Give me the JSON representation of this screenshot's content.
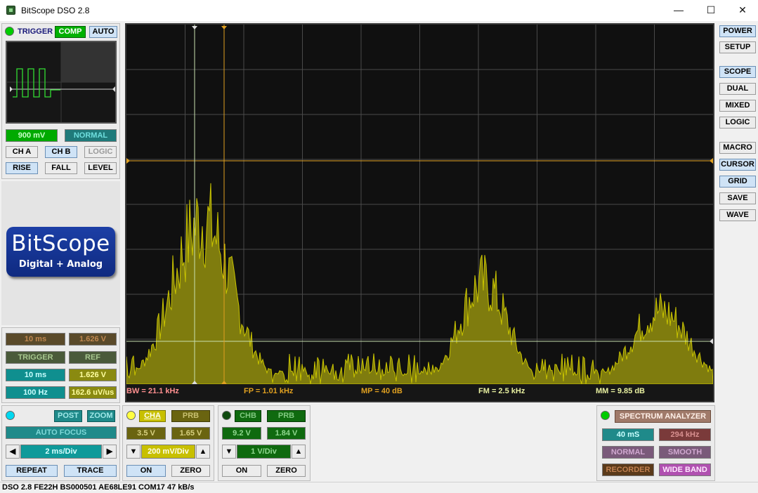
{
  "window": {
    "title": "BitScope DSO 2.8",
    "minimize": "—",
    "maximize": "☐",
    "close": "✕"
  },
  "trigger": {
    "label": "TRIGGER",
    "comp": "COMP",
    "auto": "AUTO",
    "level": "900 mV",
    "mode": "NORMAL",
    "ch_a": "CH A",
    "ch_b": "CH B",
    "logic": "LOGIC",
    "rise": "RISE",
    "fall": "FALL",
    "level_btn": "LEVEL"
  },
  "logo": {
    "line1": "BitScope",
    "line2": "Digital + Analog"
  },
  "timebase_info": {
    "r1a": "10 ms",
    "r1b": "1.626 V",
    "r2a": "TRIGGER",
    "r2b": "REF",
    "r3a": "10 ms",
    "r3b": "1.626 V",
    "r4a": "100 Hz",
    "r4b": "162.6 uV/us"
  },
  "timebase": {
    "post": "POST",
    "zoom": "ZOOM",
    "autofocus": "AUTO FOCUS",
    "value": "2 ms/Div",
    "left": "◀",
    "right": "▶",
    "repeat": "REPEAT",
    "trace": "TRACE"
  },
  "cha": {
    "label": "CHA",
    "prb": "PRB",
    "offset": "3.5 V",
    "range": "1.65 V",
    "down": "▼",
    "up": "▲",
    "div": "200 mV/Div",
    "on": "ON",
    "zero": "ZERO"
  },
  "chb": {
    "label": "CHB",
    "prb": "PRB",
    "offset": "9.2 V",
    "range": "1.84 V",
    "down": "▼",
    "up": "▲",
    "div": "1 V/Div",
    "on": "ON",
    "zero": "ZERO"
  },
  "spectrum": {
    "title": "SPECTRUM ANALYZER",
    "v1": "40 mS",
    "v2": "294 kHz",
    "normal": "NORMAL",
    "smooth": "SMOOTH",
    "recorder": "RECORDER",
    "wideband": "WIDE BAND"
  },
  "sidebar": {
    "power": "POWER",
    "setup": "SETUP",
    "scope": "SCOPE",
    "dual": "DUAL",
    "mixed": "MIXED",
    "logic": "LOGIC",
    "macro": "MACRO",
    "cursor": "CURSOR",
    "grid": "GRID",
    "save": "SAVE",
    "wave": "WAVE"
  },
  "readout": {
    "bw": "BW = 21.1 kHz",
    "fp": "FP = 1.01 kHz",
    "mp": "MP = 40 dB",
    "fm": "FM = 2.5 kHz",
    "mm": "MM = 9.85 dB"
  },
  "statusbar": {
    "text": "DSO 2.8 FE22H BS000501 AE68LE91 COM17 47 kB/s"
  },
  "colors": {
    "trace": "#c9c400",
    "trace_fill": "#7f7c0e",
    "grid": "#4a4a4a",
    "cursor": "#e0a020",
    "green_on": "#00cc00"
  }
}
